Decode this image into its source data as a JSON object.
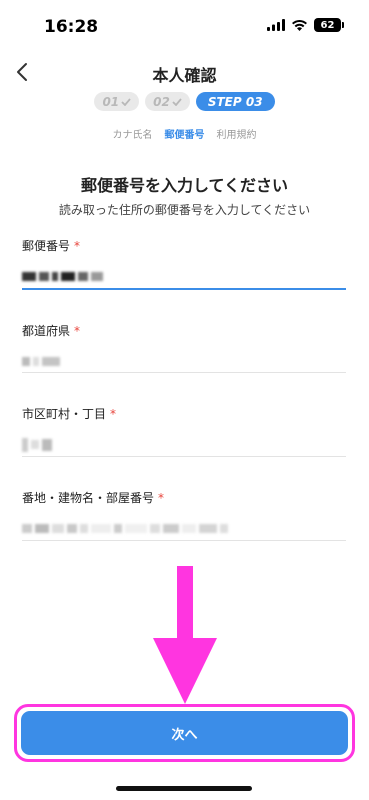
{
  "status_bar": {
    "time": "16:28",
    "battery": "62"
  },
  "header": {
    "title": "本人確認"
  },
  "steps": [
    {
      "label": "01",
      "state": "done"
    },
    {
      "label": "02",
      "state": "done"
    },
    {
      "label": "STEP 03",
      "state": "active"
    }
  ],
  "step_labels": [
    {
      "label": "カナ氏名",
      "active": false
    },
    {
      "label": "郵便番号",
      "active": true
    },
    {
      "label": "利用規約",
      "active": false
    }
  ],
  "main": {
    "heading": "郵便番号を入力してください",
    "subheading": "読み取った住所の郵便番号を入力してください"
  },
  "fields": [
    {
      "label": "郵便番号",
      "required_mark": "*"
    },
    {
      "label": "都道府県",
      "required_mark": "*"
    },
    {
      "label": "市区町村・丁目",
      "required_mark": "*"
    },
    {
      "label": "番地・建物名・部屋番号",
      "required_mark": "*"
    }
  ],
  "next_button": {
    "label": "次へ"
  },
  "colors": {
    "accent": "#3b8de8",
    "highlight": "#ff35e0",
    "required": "#e8453c"
  },
  "icons": {
    "back": "chevron-left-icon",
    "check": "check-icon",
    "signal": "cellular-signal-icon",
    "wifi": "wifi-icon",
    "battery": "battery-icon",
    "arrow": "arrow-down-icon"
  }
}
